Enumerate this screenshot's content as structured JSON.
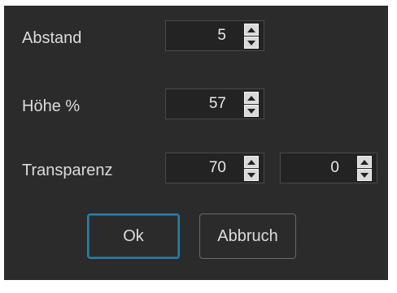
{
  "dialog": {
    "rows": {
      "abstand": {
        "label": "Abstand",
        "value": "5"
      },
      "hoehe": {
        "label": "Höhe %",
        "value": "57"
      },
      "transparenz": {
        "label": "Transparenz",
        "value_1": "70",
        "value_2": "0"
      }
    },
    "buttons": {
      "ok": "Ok",
      "cancel": "Abbruch"
    },
    "colors": {
      "background": "#2b2b2b",
      "field_background": "#232323",
      "text": "#dcdcdc",
      "focus_border": "#2a7fa8"
    }
  }
}
